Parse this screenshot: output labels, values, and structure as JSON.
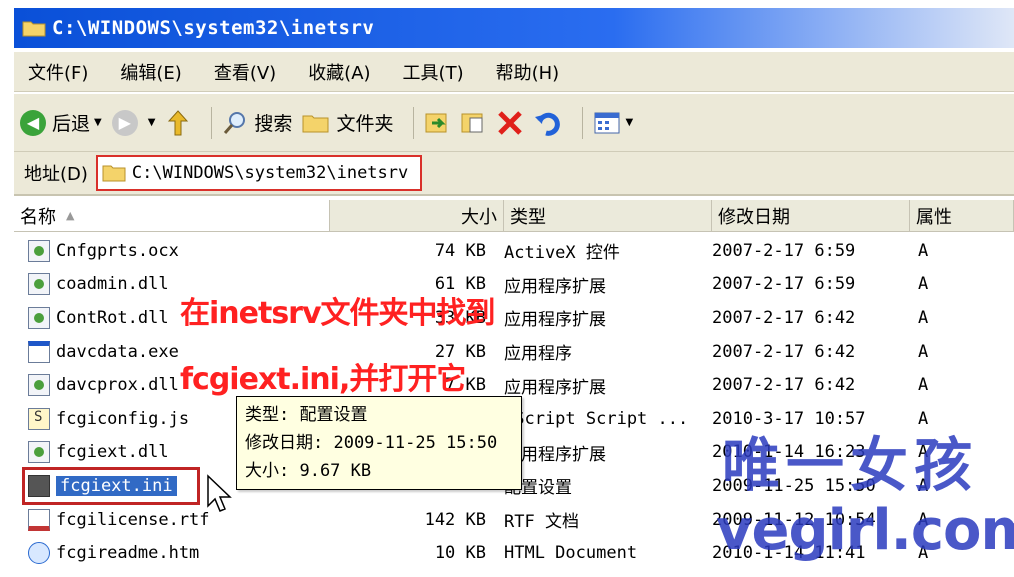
{
  "window": {
    "title": "C:\\WINDOWS\\system32\\inetsrv"
  },
  "menu": [
    {
      "label": "文件(F)"
    },
    {
      "label": "编辑(E)"
    },
    {
      "label": "查看(V)"
    },
    {
      "label": "收藏(A)"
    },
    {
      "label": "工具(T)"
    },
    {
      "label": "帮助(H)"
    }
  ],
  "toolbar": {
    "back_label": "后退",
    "search_label": "搜索",
    "folders_label": "文件夹"
  },
  "address": {
    "label": "地址(D)",
    "path": "C:\\WINDOWS\\system32\\inetsrv"
  },
  "columns": {
    "name": "名称",
    "size": "大小",
    "type": "类型",
    "modified": "修改日期",
    "attr": "属性"
  },
  "files": [
    {
      "name": "Cnfgprts.ocx",
      "size": "74 KB",
      "type": "ActiveX 控件",
      "modified": "2007-2-17 6:59",
      "attr": "A",
      "icon": "dll"
    },
    {
      "name": "coadmin.dll",
      "size": "61 KB",
      "type": "应用程序扩展",
      "modified": "2007-2-17 6:59",
      "attr": "A",
      "icon": "dll"
    },
    {
      "name": "ContRot.dll",
      "size": "33 KB",
      "type": "应用程序扩展",
      "modified": "2007-2-17 6:42",
      "attr": "A",
      "icon": "dll"
    },
    {
      "name": "davcdata.exe",
      "size": "27 KB",
      "type": "应用程序",
      "modified": "2007-2-17 6:42",
      "attr": "A",
      "icon": "exe"
    },
    {
      "name": "davcprox.dll",
      "size": "7 KB",
      "type": "应用程序扩展",
      "modified": "2007-2-17 6:42",
      "attr": "A",
      "icon": "dll"
    },
    {
      "name": "fcgiconfig.js",
      "size": "",
      "type": "JScript Script ...",
      "modified": "2010-3-17 10:57",
      "attr": "A",
      "icon": "js"
    },
    {
      "name": "fcgiext.dll",
      "size": "",
      "type": "应用程序扩展",
      "modified": "2010-1-14 16:23",
      "attr": "A",
      "icon": "dll"
    },
    {
      "name": "fcgiext.ini",
      "size": "",
      "type": "配置设置",
      "modified": "2009-11-25 15:50",
      "attr": "A",
      "icon": "ini"
    },
    {
      "name": "fcgilicense.rtf",
      "size": "142 KB",
      "type": "RTF 文档",
      "modified": "2009-11-12 10:54",
      "attr": "A",
      "icon": "rtf"
    },
    {
      "name": "fcgireadme.htm",
      "size": "10 KB",
      "type": "HTML Document",
      "modified": "2010-1-14 11:41",
      "attr": "A",
      "icon": "htm"
    }
  ],
  "tooltip": {
    "type_line": "类型: 配置设置",
    "date_line": "修改日期: 2009-11-25 15:50",
    "size_line": "大小: 9.67 KB"
  },
  "annotation": {
    "line1": "在inetsrv文件夹中找到",
    "line2": "fcgiext.ini,并打开它"
  },
  "watermark": {
    "cn": "唯一女孩",
    "url": "vegirl.com"
  },
  "colors": {
    "title_bar": "#0a50d8",
    "selection": "#316ac5",
    "highlight_box": "#c02424",
    "annotation": "#ff2121",
    "watermark": "#2b3bbf"
  }
}
